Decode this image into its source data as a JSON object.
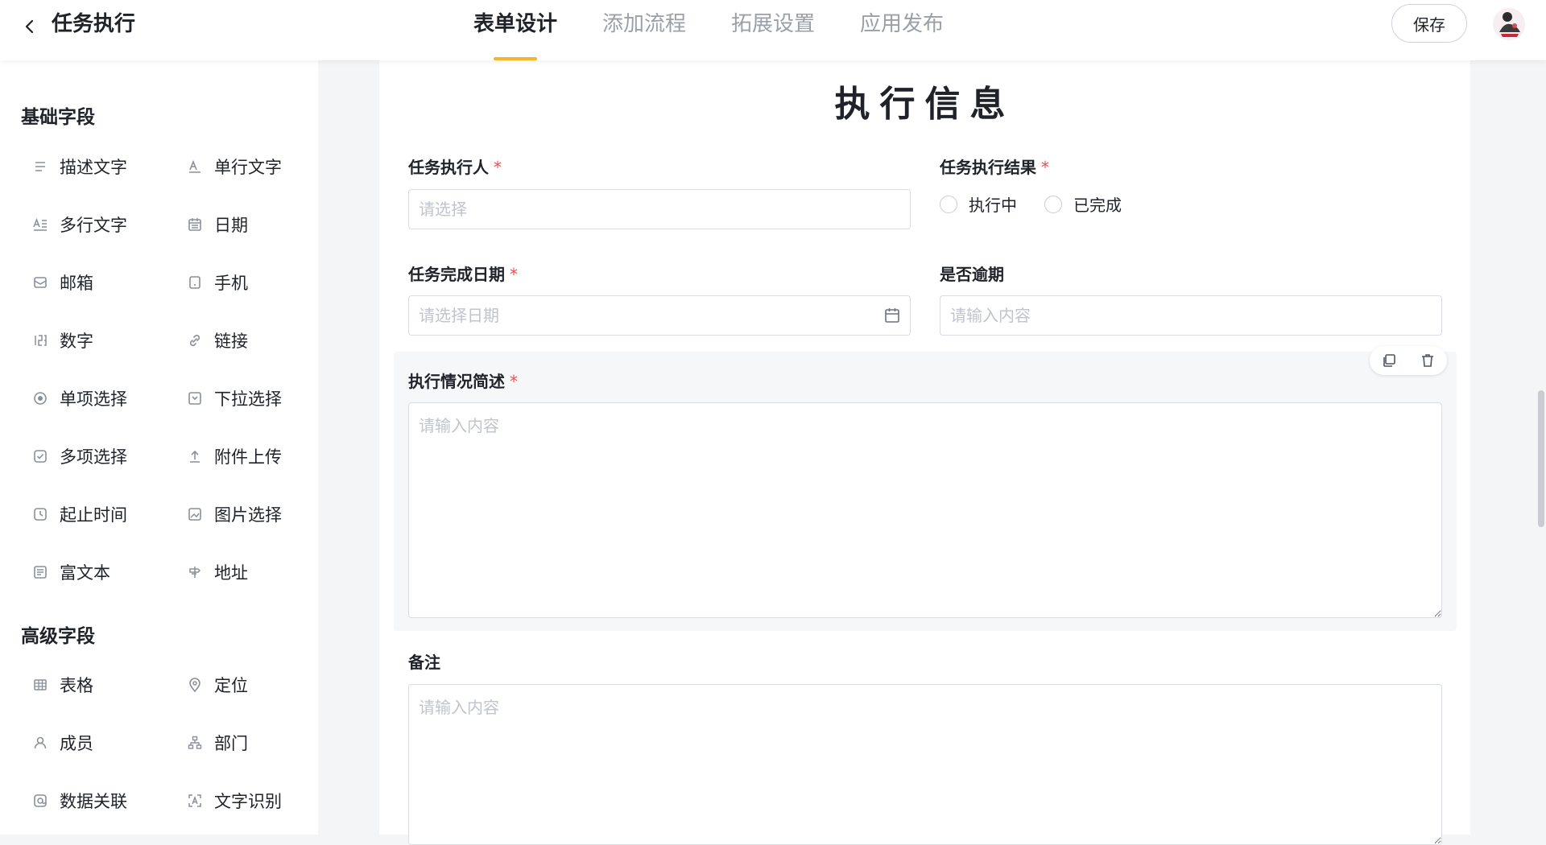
{
  "header": {
    "title": "任务执行",
    "tabs": [
      {
        "label": "表单设计",
        "active": true
      },
      {
        "label": "添加流程",
        "active": false
      },
      {
        "label": "拓展设置",
        "active": false
      },
      {
        "label": "应用发布",
        "active": false
      }
    ],
    "save_label": "保存"
  },
  "sidebar": {
    "basic_title": "基础字段",
    "basic_fields": [
      {
        "label": "描述文字",
        "icon": "description-text-icon"
      },
      {
        "label": "单行文字",
        "icon": "single-line-text-icon"
      },
      {
        "label": "多行文字",
        "icon": "multi-line-text-icon"
      },
      {
        "label": "日期",
        "icon": "calendar-icon"
      },
      {
        "label": "邮箱",
        "icon": "mail-icon"
      },
      {
        "label": "手机",
        "icon": "mobile-phone-icon"
      },
      {
        "label": "数字",
        "icon": "number-icon"
      },
      {
        "label": "链接",
        "icon": "link-icon"
      },
      {
        "label": "单项选择",
        "icon": "radio-icon"
      },
      {
        "label": "下拉选择",
        "icon": "dropdown-icon"
      },
      {
        "label": "多项选择",
        "icon": "checkbox-icon"
      },
      {
        "label": "附件上传",
        "icon": "upload-icon"
      },
      {
        "label": "起止时间",
        "icon": "time-range-icon"
      },
      {
        "label": "图片选择",
        "icon": "image-icon"
      },
      {
        "label": "富文本",
        "icon": "rich-text-icon"
      },
      {
        "label": "地址",
        "icon": "signpost-icon"
      }
    ],
    "advanced_title": "高级字段",
    "advanced_fields": [
      {
        "label": "表格",
        "icon": "table-icon"
      },
      {
        "label": "定位",
        "icon": "location-pin-icon"
      },
      {
        "label": "成员",
        "icon": "user-icon"
      },
      {
        "label": "部门",
        "icon": "org-chart-icon"
      },
      {
        "label": "数据关联",
        "icon": "data-link-icon"
      },
      {
        "label": "文字识别",
        "icon": "ocr-scan-icon"
      }
    ]
  },
  "form": {
    "title": "执行信息",
    "required_mark": "*",
    "executor": {
      "label": "任务执行人",
      "placeholder": "请选择"
    },
    "result": {
      "label": "任务执行结果",
      "options": [
        "执行中",
        "已完成"
      ]
    },
    "finish_date": {
      "label": "任务完成日期",
      "placeholder": "请选择日期"
    },
    "overdue": {
      "label": "是否逾期",
      "placeholder": "请输入内容"
    },
    "summary": {
      "label": "执行情况简述",
      "placeholder": "请输入内容"
    },
    "remark": {
      "label": "备注",
      "placeholder": "请输入内容"
    }
  },
  "colors": {
    "accent": "#f5b62a",
    "required": "#f04d4d",
    "placeholder": "#c0c4cc"
  }
}
